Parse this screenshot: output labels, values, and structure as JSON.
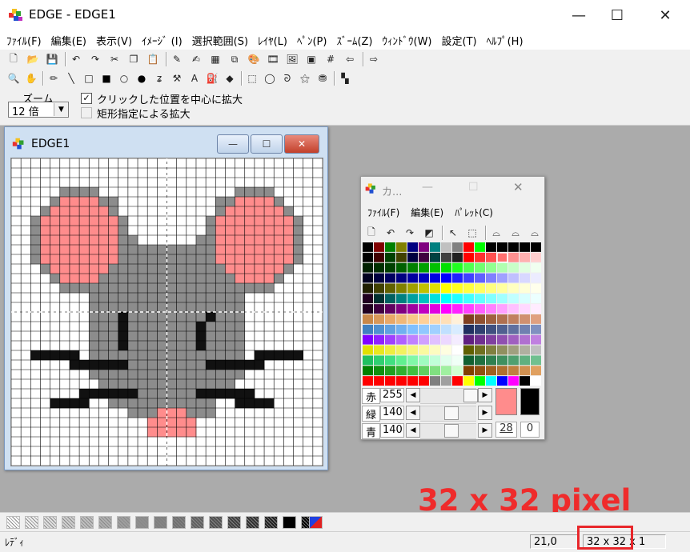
{
  "window": {
    "title": "EDGE - EDGE1",
    "minimize": "—",
    "maximize": "☐",
    "close": "✕"
  },
  "menu": [
    "ﾌｧｲﾙ(F)",
    "編集(E)",
    "表示(V)",
    "ｲﾒｰｼﾞ (I)",
    "選択範囲(S)",
    "ﾚｲﾔ(L)",
    "ﾍﾟﾝ(P)",
    "ｽﾞｰﾑ(Z)",
    "ｳｨﾝﾄﾞｳ(W)",
    "設定(T)",
    "ﾍﾙﾌﾟ(H)"
  ],
  "toolbar1_icons": [
    "new-file-icon",
    "open-folder-icon",
    "save-icon",
    "undo-icon",
    "redo-icon",
    "cut-icon",
    "copy-icon",
    "paste-icon",
    "pen-tool-icon",
    "pen-tool2-icon",
    "grid-icon",
    "layers-icon",
    "palette-icon",
    "film-icon",
    "image-icon",
    "frame-icon",
    "grid-toggle-icon",
    "arrow-left-icon",
    "arrow-right-icon"
  ],
  "toolbar2_icons": [
    "zoom-icon",
    "hand-icon",
    "pencil-icon",
    "line-icon",
    "rect-outline-icon",
    "rect-fill-icon",
    "ellipse-outline-icon",
    "ellipse-fill-icon",
    "curve-icon",
    "hammer-icon",
    "text-icon",
    "bucket-icon",
    "paint-fill-icon",
    "select-rect-icon",
    "select-ellipse-icon",
    "lasso-icon",
    "magic-select-icon",
    "stamp-icon",
    "select-color-icon"
  ],
  "zoom": {
    "label": "ズーム",
    "value": "12 倍",
    "center_checkbox": "クリックした位置を中心に拡大",
    "center_checked": true,
    "rect_checkbox": "矩形指定による拡大",
    "rect_checked": false
  },
  "document": {
    "title": "EDGE1",
    "minimize": "—",
    "maximize": "☐",
    "close": "✕",
    "pixels": [
      "................................",
      "................................",
      "................................",
      ".....GGGG..............GGGG.....",
      "....GPPPPGG..........GGPPPPG....",
      "...GPPPPPPG..........GPPPPPPG...",
      "..GPPPPPPPPG........GPPPPPPPPG..",
      "..GPPPPPPPPG........GPPPPPPPPG..",
      "..GPPPPPPPPGG......GGPPPPPPPPG..",
      "..GPPPPPPPPGGGGGGGGGGPPPPPPPPG..",
      "..GPPPPPPPPGGGGGGGGGGPPPPPPPPG..",
      "...GPPPPPPGGGGGGGGGGGGPPPPPPG...",
      "....GPPPPGGGGGGGGGGGGGGPPPPG....",
      ".....GGGGGGGGGGGGGGGGGGGGGG.....",
      "........GGGGGGGGGGGGGGGG........",
      "........GGGGGGGGGGGGGGGG........",
      "........GGGBGGGGGGGGBGGG........",
      "........GGGBGGGGGGGBGGGG........",
      "........GGGBGGGGGGGBGGGG........",
      "........GGGBGGGGGGGBGGGG........",
      "..BBBBB.GGGGGGGGGGGGGGGG.BBBBB..",
      "......BBBBBBGGGGGGGGBBBBBB......",
      "........GGGGGGGGGGGGGGGG........",
      ".........GGGGGGGGGGGGGG.........",
      ".......BBBBBBGGGGGGBBBBBB.......",
      "....BBBB..GGGGGGGGGGG..BBBB.....",
      "............GGGPPPGGG...........",
      "..............PPPPP.............",
      "..............PPPPP.............",
      "................................",
      "................................",
      "................................"
    ]
  },
  "palette_window": {
    "title": "カ...",
    "minimize": "—",
    "maximize": "☐",
    "close": "✕",
    "menu": [
      "ﾌｧｲﾙ(F)",
      "編集(E)",
      "ﾊﾟﾚｯﾄ(C)"
    ],
    "toolbar_icons": [
      "new-icon",
      "undo-icon",
      "redo-icon",
      "swap-color-icon",
      "pointer-icon",
      "select-rect-icon",
      "knob-icon",
      "knob2-icon",
      "knob3-icon"
    ],
    "rows": [
      [
        "#000000",
        "#800000",
        "#008000",
        "#808000",
        "#000080",
        "#800080",
        "#008080",
        "#c0c0c0",
        "#808080",
        "#ff0000",
        "#00ff00",
        "#000000",
        "#000000",
        "#000000",
        "#000000",
        "#000000"
      ],
      [
        "#000000",
        "#400000",
        "#004000",
        "#404000",
        "#000040",
        "#400040",
        "#004040",
        "#404040",
        "#202020",
        "#ff0000",
        "#ff3030",
        "#ff5050",
        "#ff7070",
        "#ff9090",
        "#ffb0b0",
        "#ffd0d0"
      ],
      [
        "#002000",
        "#003000",
        "#004000",
        "#006000",
        "#008000",
        "#00a000",
        "#00c000",
        "#00e000",
        "#20ff20",
        "#50ff50",
        "#70ff70",
        "#90ff90",
        "#b0ffb0",
        "#c8ffc8",
        "#e0ffe0",
        "#f0fff0"
      ],
      [
        "#000020",
        "#000040",
        "#000060",
        "#000080",
        "#0000a0",
        "#0000c0",
        "#0000e0",
        "#0000ff",
        "#2020ff",
        "#4040ff",
        "#6060ff",
        "#8080ff",
        "#a0a0ff",
        "#c0c0ff",
        "#d8d8ff",
        "#ececff"
      ],
      [
        "#202000",
        "#404000",
        "#606000",
        "#808000",
        "#a0a000",
        "#c0c000",
        "#e0e000",
        "#ffff00",
        "#ffff20",
        "#ffff40",
        "#ffff60",
        "#ffff80",
        "#ffffa0",
        "#ffffc0",
        "#ffffd8",
        "#ffffec"
      ],
      [
        "#200020",
        "#003030",
        "#006060",
        "#008080",
        "#00a0a0",
        "#00c0c0",
        "#00e0e0",
        "#00ffff",
        "#20ffff",
        "#40ffff",
        "#60ffff",
        "#80ffff",
        "#a0ffff",
        "#c0ffff",
        "#d8ffff",
        "#ecffff"
      ],
      [
        "#200020",
        "#400040",
        "#600060",
        "#800080",
        "#a000a0",
        "#c000c0",
        "#e000e0",
        "#ff00ff",
        "#ff20ff",
        "#ff40ff",
        "#ff60ff",
        "#ff80ff",
        "#ffa0ff",
        "#ffc0ff",
        "#ffd8ff",
        "#ffecff"
      ],
      [
        "#c8884a",
        "#d8985a",
        "#e8a868",
        "#f0b878",
        "#f8c888",
        "#ffd098",
        "#ffd8a8",
        "#ffe0b8",
        "#fff0d8",
        "#804020",
        "#905030",
        "#a06040",
        "#b07050",
        "#c08060",
        "#d09070",
        "#e0a080"
      ],
      [
        "#4080c0",
        "#5090d0",
        "#60a0e0",
        "#70b0f0",
        "#80c0ff",
        "#90c8ff",
        "#a0d0ff",
        "#c0e0ff",
        "#d8ecff",
        "#203060",
        "#304070",
        "#405080",
        "#506090",
        "#6070a0",
        "#7080b0",
        "#8090c0"
      ],
      [
        "#8000ff",
        "#9020ff",
        "#a040ff",
        "#b060ff",
        "#c080ff",
        "#d0a0ff",
        "#e0c0ff",
        "#ecd8ff",
        "#f4ecff",
        "#602080",
        "#703090",
        "#8040a0",
        "#9050b0",
        "#a060c0",
        "#b070d0",
        "#c080e0"
      ],
      [
        "#e0e000",
        "#e8e820",
        "#eeee40",
        "#f2f260",
        "#f6f680",
        "#fafaa0",
        "#fcfcc0",
        "#fefee0",
        "#ffffff",
        "#606000",
        "#707020",
        "#808040",
        "#909060",
        "#a0a080",
        "#b0b0a0",
        "#c0c0c0"
      ],
      [
        "#20c060",
        "#30d070",
        "#40e080",
        "#60f090",
        "#80f8a8",
        "#a0fcc0",
        "#c0ffd8",
        "#e0ffec",
        "#f0fff6",
        "#106030",
        "#207040",
        "#308050",
        "#409060",
        "#50a070",
        "#60b080",
        "#70c090"
      ],
      [
        "#008000",
        "#109010",
        "#20a020",
        "#30b030",
        "#40c040",
        "#60d060",
        "#80e080",
        "#a0f0a0",
        "#d0ffd0",
        "#804000",
        "#905010",
        "#a06020",
        "#b07030",
        "#c08040",
        "#d09050",
        "#e0a060"
      ],
      [
        "#ff0000",
        "#ff0000",
        "#ff0000",
        "#ff0000",
        "#ff0000",
        "#ff0000",
        "#808080",
        "#a0a0a0",
        "#ff0000",
        "#ffff00",
        "#00ff00",
        "#00ffff",
        "#0000ff",
        "#ff00ff",
        "#000000",
        "#ffffff"
      ]
    ],
    "labels": [
      "赤",
      "緑",
      "青"
    ],
    "values": [
      "255",
      "140",
      "140"
    ],
    "fg_color": "#ff8c8c",
    "bg_color": "#000000",
    "index": "28",
    "zero": "0"
  },
  "status": {
    "text": "ﾚﾃﾞｨ",
    "coords": "21,0",
    "size": "32 x 32 x 1"
  },
  "annotation": "32 x 32 pixel"
}
